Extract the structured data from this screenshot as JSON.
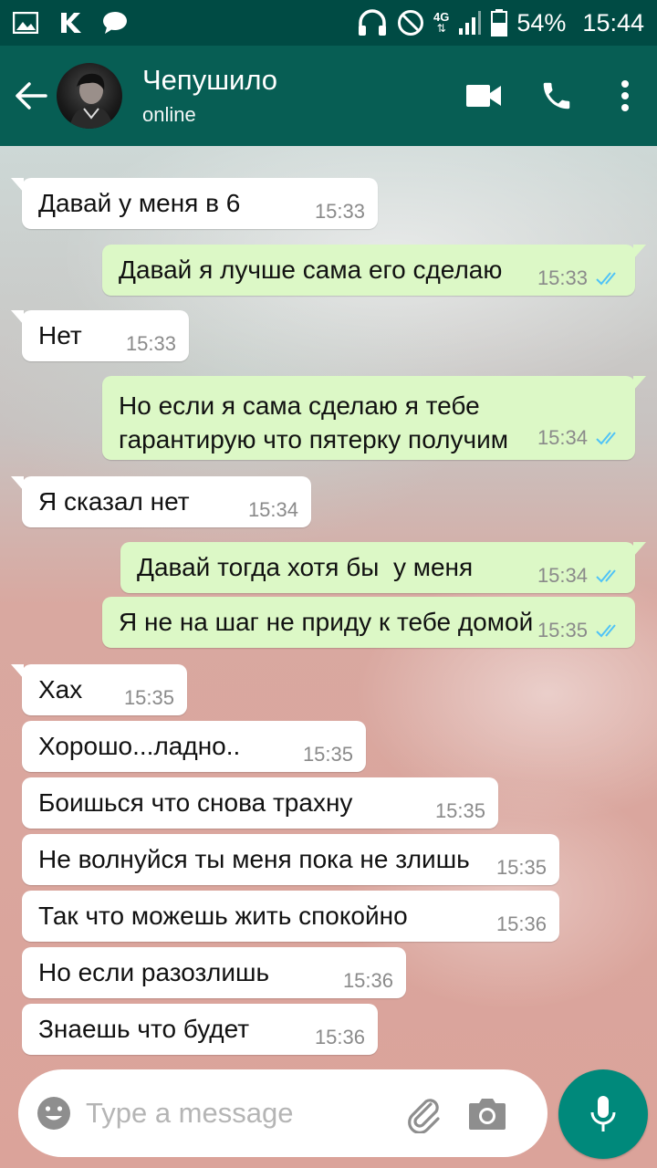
{
  "status_bar": {
    "network": "4G",
    "battery": "54%",
    "time": "15:44"
  },
  "header": {
    "contact_name": "Чепушило",
    "contact_status": "online",
    "icons": [
      "back-arrow-icon",
      "video-call-icon",
      "phone-icon",
      "more-vert-icon"
    ]
  },
  "messages": [
    {
      "dir": "in",
      "text": "Давай у меня в 6",
      "time": "15:33"
    },
    {
      "dir": "out",
      "text": "Давай я лучше сама его сделаю",
      "time": "15:33"
    },
    {
      "dir": "in",
      "text": "Нет",
      "time": "15:33"
    },
    {
      "dir": "out",
      "text": "Но если я сама сделаю я тебе гарантирую что пятерку получим",
      "time": "15:34"
    },
    {
      "dir": "in",
      "text": "Я сказал нет",
      "time": "15:34"
    },
    {
      "dir": "out",
      "text": "Давай тогда хотя бы  у меня",
      "time": "15:34"
    },
    {
      "dir": "out",
      "text": "Я не на шаг не приду к тебе домой",
      "time": "15:35"
    },
    {
      "dir": "in",
      "text": "Хах",
      "time": "15:35"
    },
    {
      "dir": "in",
      "text": "Хорошо...ладно..",
      "time": "15:35"
    },
    {
      "dir": "in",
      "text": "Боишься что снова трахну",
      "time": "15:35"
    },
    {
      "dir": "in",
      "text": "Не волнуйся ты меня пока не злишь",
      "time": "15:35"
    },
    {
      "dir": "in",
      "text": "Так что можешь жить спокойно",
      "time": "15:36"
    },
    {
      "dir": "in",
      "text": "Но если разозлишь",
      "time": "15:36"
    },
    {
      "dir": "in",
      "text": "Знаешь что будет",
      "time": "15:36"
    }
  ],
  "input": {
    "placeholder": "Type a message"
  },
  "colors": {
    "status_bar": "#004b44",
    "app_bar": "#075e54",
    "outgoing_bubble": "#dcf8c6",
    "incoming_bubble": "#ffffff",
    "read_ticks": "#4fc3f7",
    "mic_button": "#00897b"
  }
}
